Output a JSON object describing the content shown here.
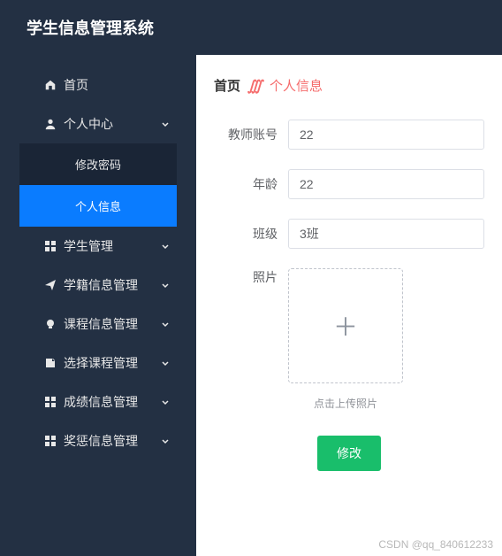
{
  "header": {
    "title": "学生信息管理系统"
  },
  "sidebar": {
    "items": [
      {
        "icon": "home-icon",
        "label": "首页",
        "expandable": false
      },
      {
        "icon": "person-icon",
        "label": "个人中心",
        "expandable": true,
        "expanded": true
      },
      {
        "icon": "grid-icon",
        "label": "学生管理",
        "expandable": true
      },
      {
        "icon": "send-icon",
        "label": "学籍信息管理",
        "expandable": true
      },
      {
        "icon": "bulb-icon",
        "label": "课程信息管理",
        "expandable": true
      },
      {
        "icon": "book-icon",
        "label": "选择课程管理",
        "expandable": true
      },
      {
        "icon": "grid-icon",
        "label": "成绩信息管理",
        "expandable": true
      },
      {
        "icon": "grid-icon",
        "label": "奖惩信息管理",
        "expandable": true
      }
    ],
    "sub_items": [
      {
        "label": "修改密码",
        "active": false
      },
      {
        "label": "个人信息",
        "active": true
      }
    ]
  },
  "breadcrumb": {
    "home": "首页",
    "separator": "∭",
    "current": "个人信息"
  },
  "form": {
    "fields": [
      {
        "label": "教师账号",
        "value": "22"
      },
      {
        "label": "年龄",
        "value": "22"
      },
      {
        "label": "班级",
        "value": "3班"
      }
    ],
    "photo_label": "照片",
    "upload_tip": "点击上传照片",
    "submit_label": "修改"
  },
  "watermark": "CSDN @qq_840612233"
}
